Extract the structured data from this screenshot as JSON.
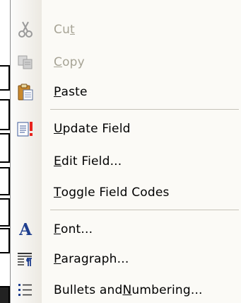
{
  "menu": {
    "items": [
      {
        "pre": "Cu",
        "key": "t",
        "post": "",
        "enabled": false,
        "icon": "scissors-icon"
      },
      {
        "pre": "",
        "key": "C",
        "post": "opy",
        "enabled": false,
        "icon": "copy-icon"
      },
      {
        "pre": "",
        "key": "P",
        "post": "aste",
        "enabled": true,
        "icon": "clipboard-icon"
      },
      {
        "pre": "",
        "key": "U",
        "post": "pdate Field",
        "enabled": true,
        "icon": "update-field-icon"
      },
      {
        "pre": "",
        "key": "E",
        "post": "dit Field...",
        "enabled": true,
        "icon": ""
      },
      {
        "pre": "",
        "key": "T",
        "post": "oggle Field Codes",
        "enabled": true,
        "icon": ""
      },
      {
        "pre": "",
        "key": "F",
        "post": "ont...",
        "enabled": true,
        "icon": "font-icon"
      },
      {
        "pre": "",
        "key": "P",
        "post": "aragraph...",
        "enabled": true,
        "icon": "paragraph-icon"
      },
      {
        "pre": "Bullets and ",
        "key": "N",
        "post": "umbering...",
        "enabled": true,
        "icon": "bullets-icon"
      }
    ]
  },
  "icon_glyphs": {
    "font": "A"
  },
  "colors": {
    "disabled_text": "#a6a395",
    "menu_bg": "#fbfaf6",
    "gutter": "#ece9e2",
    "separator": "#c5c2b8"
  }
}
